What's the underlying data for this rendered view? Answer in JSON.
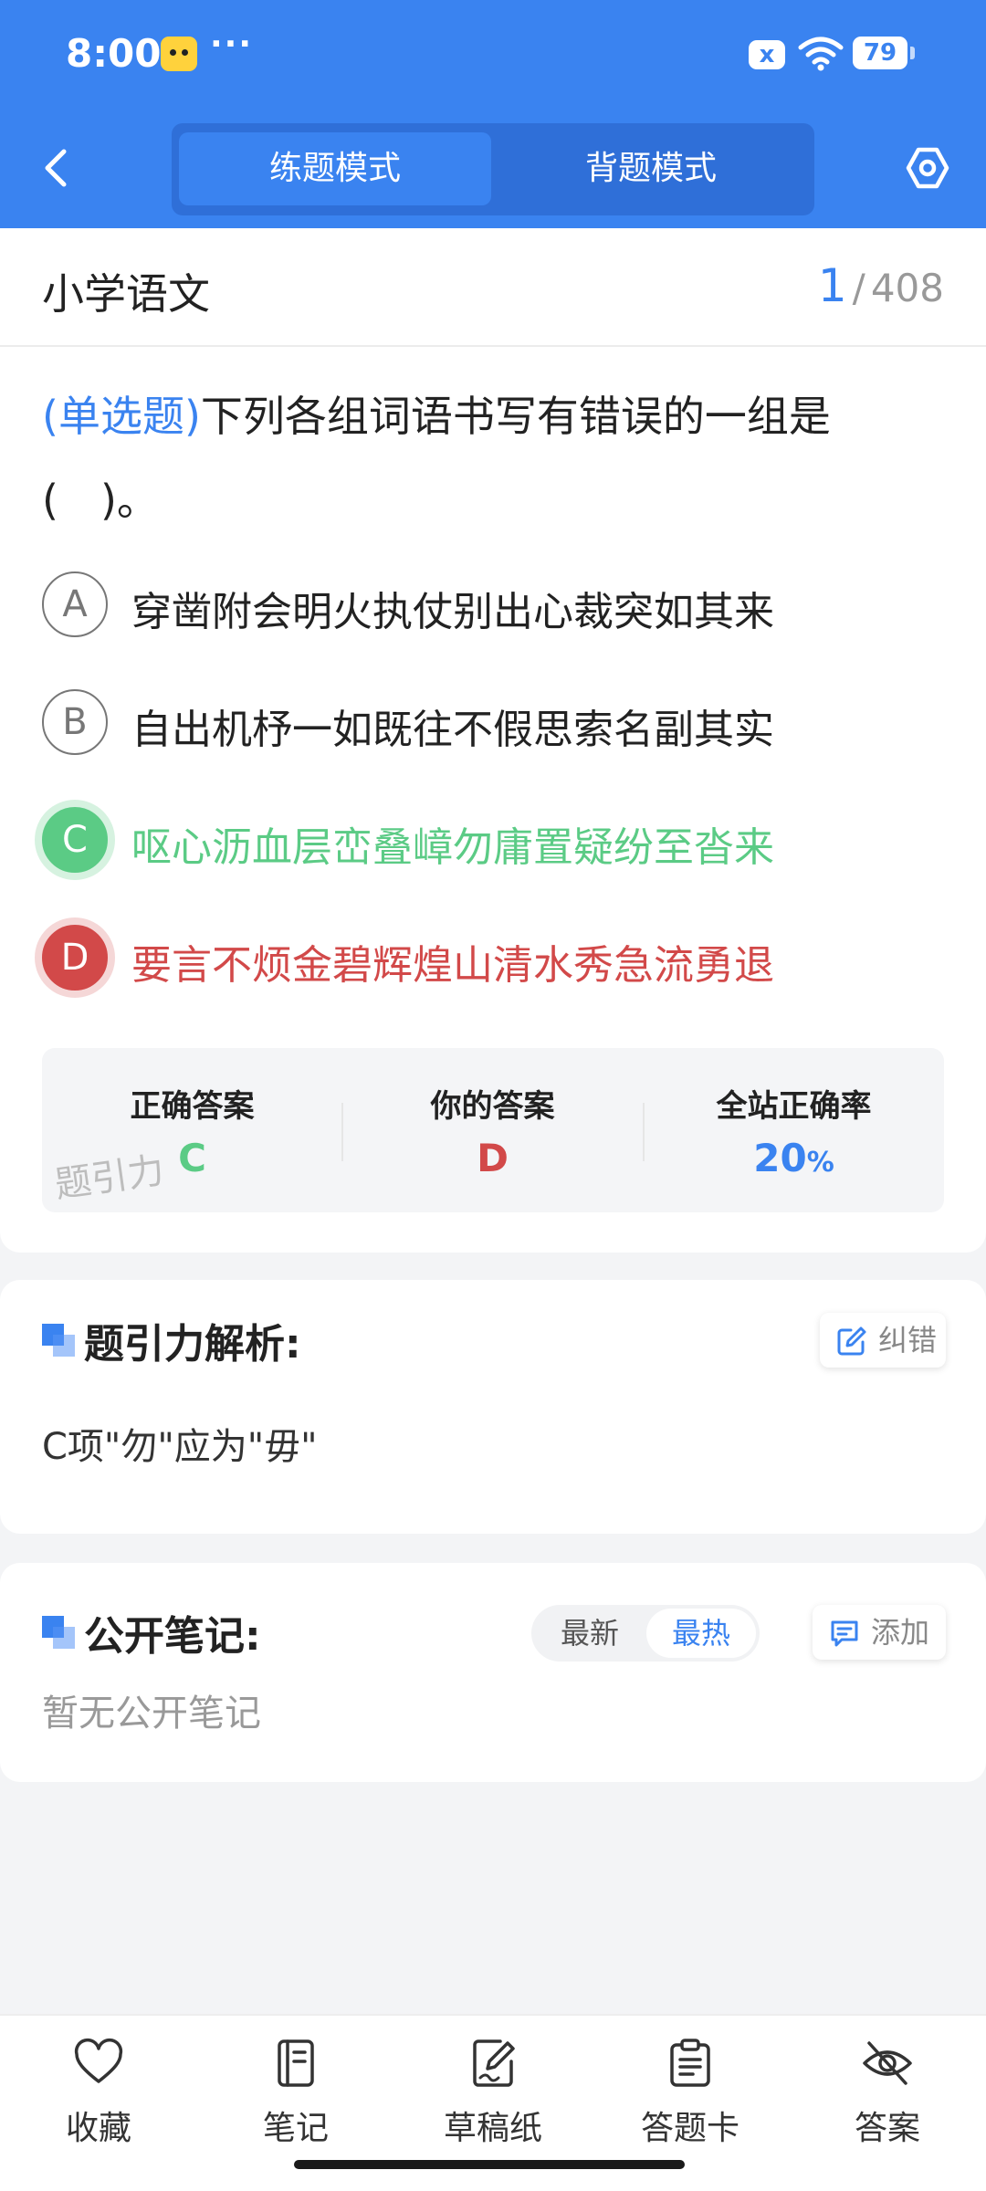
{
  "status_bar": {
    "time": "8:00",
    "more": "···",
    "sim_icon": "x",
    "battery": "79"
  },
  "header": {
    "tabs": [
      {
        "label": "练题模式",
        "active": true
      },
      {
        "label": "背题模式",
        "active": false
      }
    ]
  },
  "subject": {
    "title": "小学语文",
    "current": "1",
    "separator": "/",
    "total": "408"
  },
  "question": {
    "type": "(单选题)",
    "text": "下列各组词语书写有错误的一组是(　)。",
    "options": [
      {
        "letter": "A",
        "text": "穿凿附会明火执仗别出心裁突如其来",
        "state": "normal"
      },
      {
        "letter": "B",
        "text": "自出机杼一如既往不假思索名副其实",
        "state": "normal"
      },
      {
        "letter": "C",
        "text": "呕心沥血层峦叠嶂勿庸置疑纷至沓来",
        "state": "correct"
      },
      {
        "letter": "D",
        "text": "要言不烦金碧辉煌山清水秀急流勇退",
        "state": "wrong"
      }
    ]
  },
  "answer_summary": {
    "correct_label": "正确答案",
    "correct_value": "C",
    "yours_label": "你的答案",
    "yours_value": "D",
    "rate_label": "全站正确率",
    "rate_value": "20",
    "rate_unit": "%",
    "watermark": "题引力"
  },
  "analysis": {
    "title": "题引力解析:",
    "report_label": "纠错",
    "text": "C项\"勿\"应为\"毋\""
  },
  "notes": {
    "title": "公开笔记:",
    "sort_newest": "最新",
    "sort_hottest": "最热",
    "add_label": "添加",
    "empty_text": "暂无公开笔记"
  },
  "bottom_nav": [
    {
      "label": "收藏",
      "icon": "heart-icon"
    },
    {
      "label": "笔记",
      "icon": "notebook-icon"
    },
    {
      "label": "草稿纸",
      "icon": "draft-icon"
    },
    {
      "label": "答题卡",
      "icon": "clipboard-icon"
    },
    {
      "label": "答案",
      "icon": "eye-off-icon"
    }
  ],
  "colors": {
    "brand": "#3a83f0",
    "correct": "#5bcb85",
    "wrong": "#d24949"
  }
}
